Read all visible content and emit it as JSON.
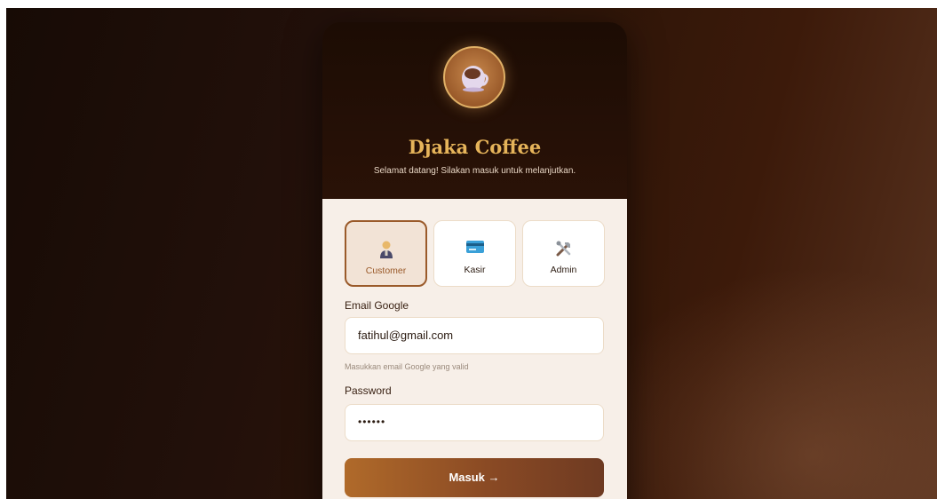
{
  "brand": {
    "name": "Djaka Coffee",
    "tagline": "Selamat datang! Silakan masuk untuk melanjutkan.",
    "logo_icon": "coffee-cup-icon"
  },
  "roles": [
    {
      "label": "Customer",
      "icon": "customer-icon",
      "active": true
    },
    {
      "label": "Kasir",
      "icon": "credit-card-icon",
      "active": false
    },
    {
      "label": "Admin",
      "icon": "tools-icon",
      "active": false
    }
  ],
  "form": {
    "email_label": "Email Google",
    "email_value": "fatihul@gmail.com",
    "email_hint": "Masukkan email Google yang valid",
    "password_label": "Password",
    "password_value": "••••••",
    "submit_label": "Masuk →"
  },
  "colors": {
    "accent": "#e6b45a",
    "active_border": "#9a5a2a",
    "button_start": "#b06a2a",
    "button_end": "#6e3a22"
  }
}
